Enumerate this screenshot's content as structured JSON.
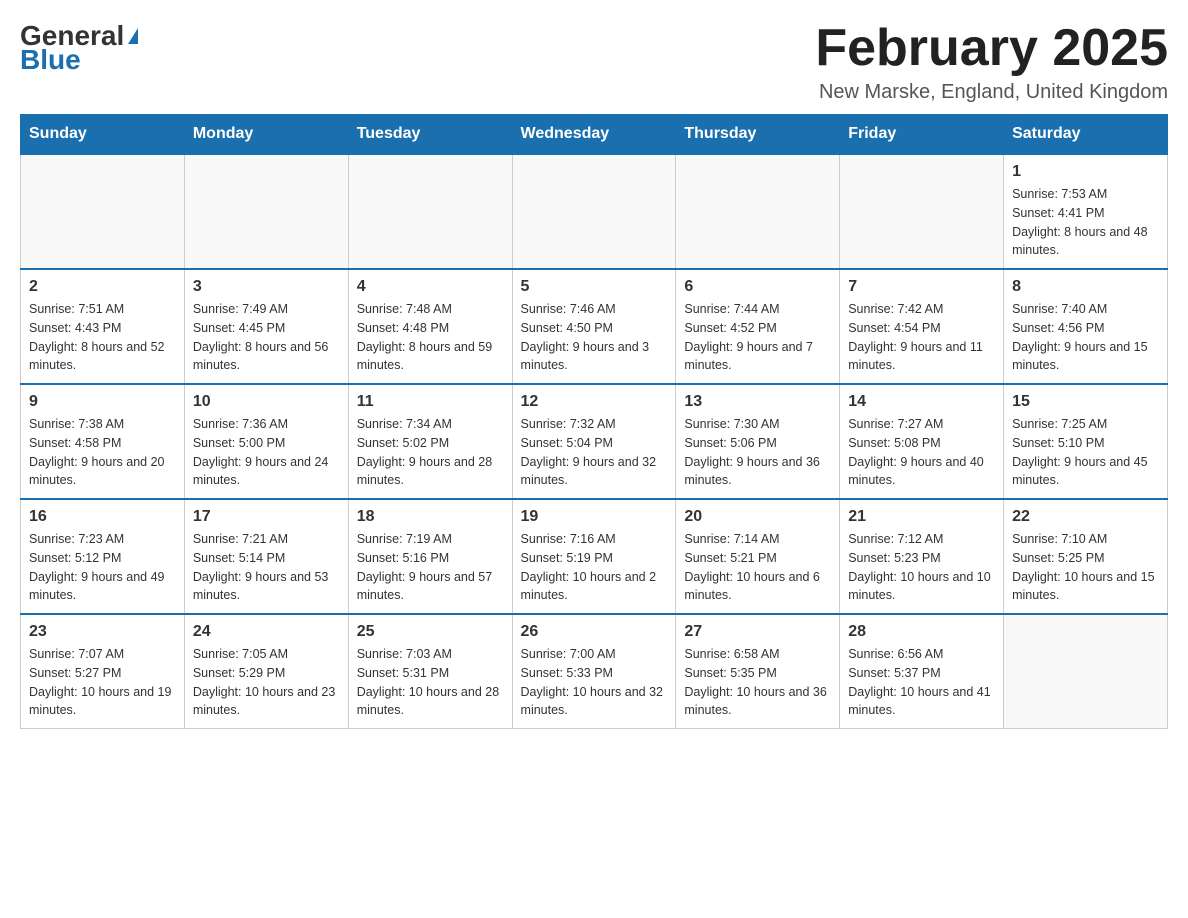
{
  "header": {
    "logo_general": "General",
    "logo_blue": "Blue",
    "month_title": "February 2025",
    "location": "New Marske, England, United Kingdom"
  },
  "weekdays": [
    "Sunday",
    "Monday",
    "Tuesday",
    "Wednesday",
    "Thursday",
    "Friday",
    "Saturday"
  ],
  "weeks": [
    [
      {
        "day": "",
        "info": ""
      },
      {
        "day": "",
        "info": ""
      },
      {
        "day": "",
        "info": ""
      },
      {
        "day": "",
        "info": ""
      },
      {
        "day": "",
        "info": ""
      },
      {
        "day": "",
        "info": ""
      },
      {
        "day": "1",
        "info": "Sunrise: 7:53 AM\nSunset: 4:41 PM\nDaylight: 8 hours and 48 minutes."
      }
    ],
    [
      {
        "day": "2",
        "info": "Sunrise: 7:51 AM\nSunset: 4:43 PM\nDaylight: 8 hours and 52 minutes."
      },
      {
        "day": "3",
        "info": "Sunrise: 7:49 AM\nSunset: 4:45 PM\nDaylight: 8 hours and 56 minutes."
      },
      {
        "day": "4",
        "info": "Sunrise: 7:48 AM\nSunset: 4:48 PM\nDaylight: 8 hours and 59 minutes."
      },
      {
        "day": "5",
        "info": "Sunrise: 7:46 AM\nSunset: 4:50 PM\nDaylight: 9 hours and 3 minutes."
      },
      {
        "day": "6",
        "info": "Sunrise: 7:44 AM\nSunset: 4:52 PM\nDaylight: 9 hours and 7 minutes."
      },
      {
        "day": "7",
        "info": "Sunrise: 7:42 AM\nSunset: 4:54 PM\nDaylight: 9 hours and 11 minutes."
      },
      {
        "day": "8",
        "info": "Sunrise: 7:40 AM\nSunset: 4:56 PM\nDaylight: 9 hours and 15 minutes."
      }
    ],
    [
      {
        "day": "9",
        "info": "Sunrise: 7:38 AM\nSunset: 4:58 PM\nDaylight: 9 hours and 20 minutes."
      },
      {
        "day": "10",
        "info": "Sunrise: 7:36 AM\nSunset: 5:00 PM\nDaylight: 9 hours and 24 minutes."
      },
      {
        "day": "11",
        "info": "Sunrise: 7:34 AM\nSunset: 5:02 PM\nDaylight: 9 hours and 28 minutes."
      },
      {
        "day": "12",
        "info": "Sunrise: 7:32 AM\nSunset: 5:04 PM\nDaylight: 9 hours and 32 minutes."
      },
      {
        "day": "13",
        "info": "Sunrise: 7:30 AM\nSunset: 5:06 PM\nDaylight: 9 hours and 36 minutes."
      },
      {
        "day": "14",
        "info": "Sunrise: 7:27 AM\nSunset: 5:08 PM\nDaylight: 9 hours and 40 minutes."
      },
      {
        "day": "15",
        "info": "Sunrise: 7:25 AM\nSunset: 5:10 PM\nDaylight: 9 hours and 45 minutes."
      }
    ],
    [
      {
        "day": "16",
        "info": "Sunrise: 7:23 AM\nSunset: 5:12 PM\nDaylight: 9 hours and 49 minutes."
      },
      {
        "day": "17",
        "info": "Sunrise: 7:21 AM\nSunset: 5:14 PM\nDaylight: 9 hours and 53 minutes."
      },
      {
        "day": "18",
        "info": "Sunrise: 7:19 AM\nSunset: 5:16 PM\nDaylight: 9 hours and 57 minutes."
      },
      {
        "day": "19",
        "info": "Sunrise: 7:16 AM\nSunset: 5:19 PM\nDaylight: 10 hours and 2 minutes."
      },
      {
        "day": "20",
        "info": "Sunrise: 7:14 AM\nSunset: 5:21 PM\nDaylight: 10 hours and 6 minutes."
      },
      {
        "day": "21",
        "info": "Sunrise: 7:12 AM\nSunset: 5:23 PM\nDaylight: 10 hours and 10 minutes."
      },
      {
        "day": "22",
        "info": "Sunrise: 7:10 AM\nSunset: 5:25 PM\nDaylight: 10 hours and 15 minutes."
      }
    ],
    [
      {
        "day": "23",
        "info": "Sunrise: 7:07 AM\nSunset: 5:27 PM\nDaylight: 10 hours and 19 minutes."
      },
      {
        "day": "24",
        "info": "Sunrise: 7:05 AM\nSunset: 5:29 PM\nDaylight: 10 hours and 23 minutes."
      },
      {
        "day": "25",
        "info": "Sunrise: 7:03 AM\nSunset: 5:31 PM\nDaylight: 10 hours and 28 minutes."
      },
      {
        "day": "26",
        "info": "Sunrise: 7:00 AM\nSunset: 5:33 PM\nDaylight: 10 hours and 32 minutes."
      },
      {
        "day": "27",
        "info": "Sunrise: 6:58 AM\nSunset: 5:35 PM\nDaylight: 10 hours and 36 minutes."
      },
      {
        "day": "28",
        "info": "Sunrise: 6:56 AM\nSunset: 5:37 PM\nDaylight: 10 hours and 41 minutes."
      },
      {
        "day": "",
        "info": ""
      }
    ]
  ]
}
